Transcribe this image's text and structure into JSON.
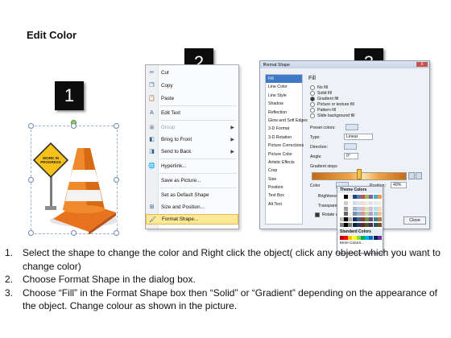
{
  "title": "Edit Color",
  "steps": [
    "1",
    "2",
    "3"
  ],
  "sign_text": "WORK IN PROGRESS",
  "menu": {
    "items": [
      {
        "label": "Cut",
        "icon": "cut-icon",
        "glyph": "✂"
      },
      {
        "label": "Copy",
        "icon": "copy-icon",
        "glyph": "❐"
      },
      {
        "label": "Paste",
        "icon": "paste-icon",
        "glyph": "📋"
      },
      {
        "label": "Edit Text",
        "icon": "edit-text-icon",
        "glyph": "A"
      },
      {
        "label": "Group",
        "icon": "group-icon",
        "glyph": "▣",
        "disabled": true,
        "submenu": true
      },
      {
        "label": "Bring to Front",
        "icon": "bring-front-icon",
        "glyph": "◧",
        "submenu": true
      },
      {
        "label": "Send to Back",
        "icon": "send-back-icon",
        "glyph": "◨",
        "submenu": true
      },
      {
        "label": "Hyperlink...",
        "icon": "hyperlink-icon",
        "glyph": "🌐"
      },
      {
        "label": "Save as Picture...",
        "icon": "",
        "glyph": ""
      },
      {
        "label": "Set as Default Shape",
        "icon": "",
        "glyph": ""
      },
      {
        "label": "Size and Position...",
        "icon": "size-position-icon",
        "glyph": "⊞"
      },
      {
        "label": "Format Shape...",
        "icon": "format-shape-icon",
        "glyph": "🖌",
        "highlighted": true
      }
    ]
  },
  "dialog": {
    "title": "Format Shape",
    "help": "?",
    "close_x": "X",
    "categories": [
      "Fill",
      "Line Color",
      "Line Style",
      "Shadow",
      "Reflection",
      "Glow and Soft Edges",
      "3-D Format",
      "3-D Rotation",
      "Picture Corrections",
      "Picture Color",
      "Artistic Effects",
      "Crop",
      "Size",
      "Position",
      "Text Box",
      "Alt Text"
    ],
    "fill_header": "Fill",
    "fill_options": [
      "No fill",
      "Solid fill",
      "Gradient fill",
      "Picture or texture fill",
      "Pattern fill",
      "Slide background fill"
    ],
    "preset_colors": "Preset colors:",
    "type_label": "Type:",
    "type_value": "Linear",
    "direction_label": "Direction:",
    "angle_label": "Angle:",
    "angle_value": "0°",
    "gradient_stops": "Gradient stops",
    "color_label": "Color",
    "position_label": "Position:",
    "position_value": "49%",
    "brightness_label": "Brightness",
    "transparency_label": "Transparency",
    "rotate_label": "Rotate w",
    "close_button": "Close"
  },
  "palette": {
    "theme_header": "Theme Colors",
    "standard_header": "Standard Colors",
    "more_colors": "More Colors...",
    "theme_row": [
      "#ffffff",
      "#000000",
      "#eeece1",
      "#1f497d",
      "#4f81bd",
      "#c0504d",
      "#9bbb59",
      "#8064a2",
      "#4bacc6",
      "#f79646"
    ],
    "standard_row": [
      "#c00000",
      "#ff0000",
      "#ffc000",
      "#ffff00",
      "#92d050",
      "#00b050",
      "#00b0f0",
      "#0070c0",
      "#002060",
      "#7030a0"
    ]
  },
  "instructions": [
    {
      "num": "1.",
      "text": "Select the shape to change the color and Right click the object( click any object which you want to change color)"
    },
    {
      "num": "2.",
      "text": "Choose Format Shape in the dialog box."
    },
    {
      "num": "3.",
      "text": "Choose “Fill” in the Format Shape box then “Solid” or “Gradient” depending on the appearance of the object. Change colour as shown in the picture."
    }
  ]
}
